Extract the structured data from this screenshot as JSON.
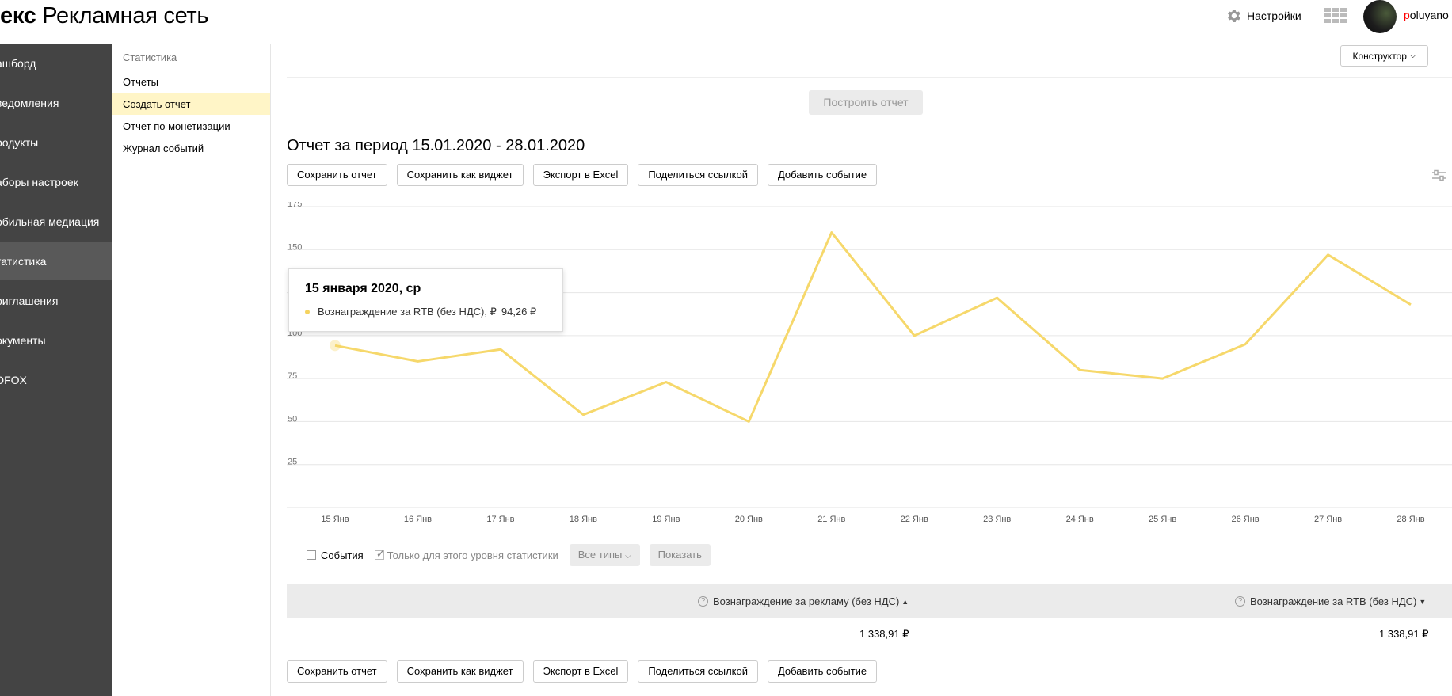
{
  "header": {
    "logo_bold": "екс",
    "logo_text": "Рекламная сеть",
    "settings_label": "Настройки",
    "username_first": "p",
    "username_rest": "oluyano"
  },
  "leftnav": {
    "items": [
      {
        "label": "ашборд"
      },
      {
        "label": "ведомления"
      },
      {
        "label": "родукты"
      },
      {
        "label": "аборы настроек"
      },
      {
        "label": "обильная медиация"
      },
      {
        "label": "татистика",
        "active": true
      },
      {
        "label": "риглашения"
      },
      {
        "label": "окументы"
      },
      {
        "label": "DFOX"
      }
    ]
  },
  "subnav": {
    "title": "Статистика",
    "items": [
      {
        "label": "Отчеты"
      },
      {
        "label": "Создать отчет",
        "active": true
      },
      {
        "label": "Отчет по монетизации"
      },
      {
        "label": "Журнал событий"
      }
    ]
  },
  "toolbar": {
    "constructor_label": "Конструктор",
    "build_label": "Построить отчет"
  },
  "report": {
    "title": "Отчет за период 15.01.2020 - 28.01.2020",
    "actions": [
      "Сохранить отчет",
      "Сохранить как виджет",
      "Экспорт в Excel",
      "Поделиться ссылкой",
      "Добавить событие"
    ]
  },
  "chart_data": {
    "type": "line",
    "categories": [
      "15 Янв",
      "16 Янв",
      "17 Янв",
      "18 Янв",
      "19 Янв",
      "20 Янв",
      "21 Янв",
      "22 Янв",
      "23 Янв",
      "24 Янв",
      "25 Янв",
      "26 Янв",
      "27 Янв",
      "28 Янв"
    ],
    "series": [
      {
        "name": "Вознаграждение за RTB (без НДС)",
        "values": [
          94.26,
          85,
          92,
          54,
          73,
          50,
          160,
          100,
          122,
          80,
          75,
          95,
          147,
          118
        ],
        "color": "#f6d86b"
      }
    ],
    "yticks": [
      25,
      50,
      75,
      100,
      125,
      150,
      175
    ],
    "ylim": [
      0,
      175
    ],
    "grid": true
  },
  "tooltip": {
    "date": "15 января 2020, ср",
    "series_label": "Вознаграждение за RTB (без НДС), ₽",
    "value": "94,26 ₽"
  },
  "events": {
    "events_label": "События",
    "only_level_label": "Только для этого уровня статистики",
    "all_types_label": "Все типы",
    "show_label": "Показать"
  },
  "table": {
    "columns": [
      "Вознаграждение за рекламу (без НДС)",
      "Вознаграждение за RTB (без НДС)"
    ],
    "row": [
      "1 338,91 ₽",
      "1 338,91 ₽"
    ]
  }
}
